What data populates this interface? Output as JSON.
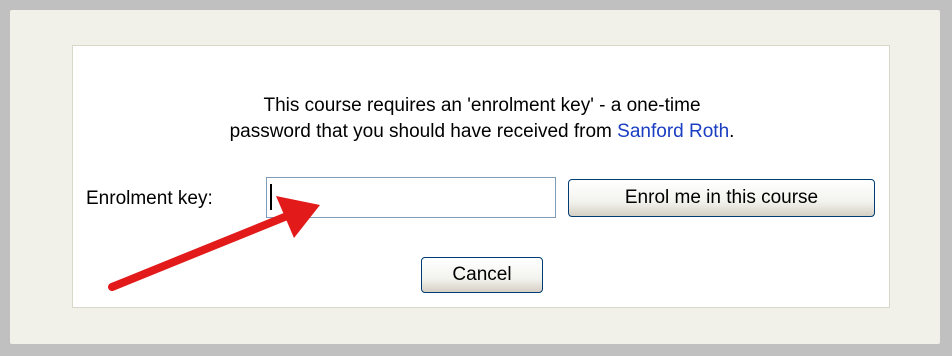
{
  "enrolment": {
    "message_line1": "This course requires an 'enrolment key' - a one-time",
    "message_line2_prefix": "password that you should have received from ",
    "teacher_name": "Sanford Roth",
    "message_line2_suffix": ".",
    "key_label": "Enrolment key:",
    "key_value": "",
    "enrol_button_label": "Enrol me in this course",
    "cancel_button_label": "Cancel"
  },
  "colors": {
    "link": "#1a3dc1",
    "arrow": "#e21a1a",
    "panel_bg": "#f1f1ea",
    "outer_bg": "#c0c0c0"
  },
  "annotation": {
    "arrow_icon": "red-arrow-icon"
  }
}
